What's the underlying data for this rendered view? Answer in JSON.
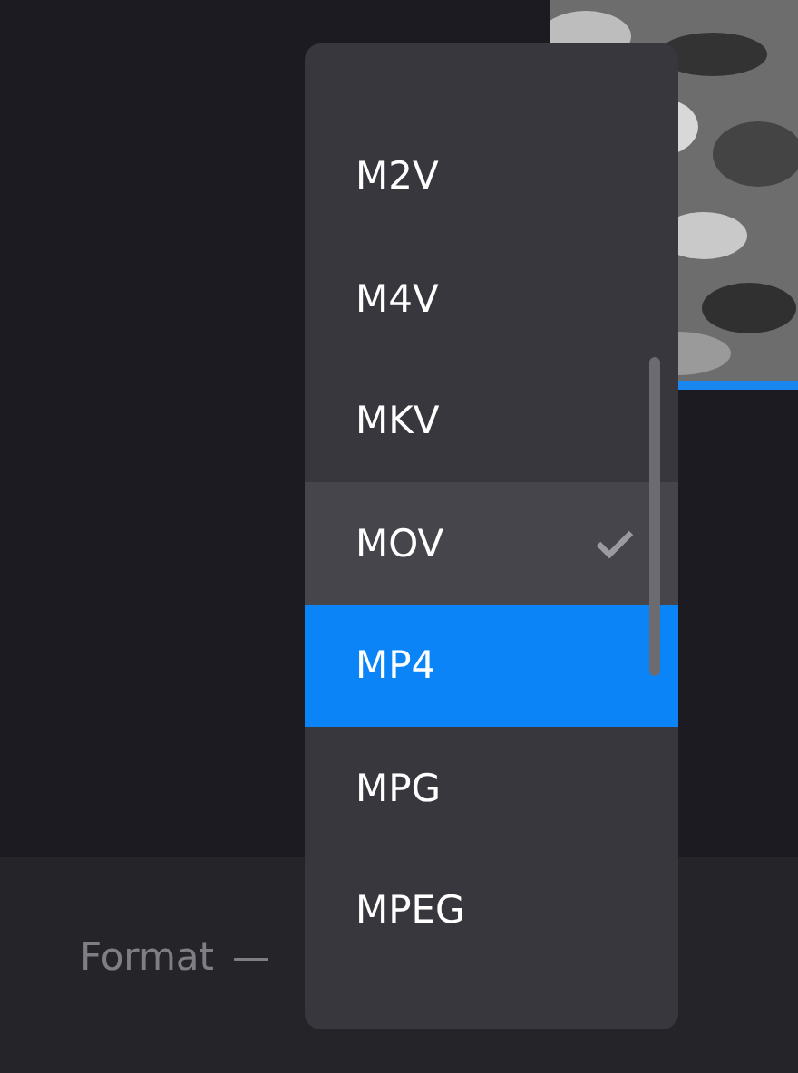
{
  "preview": {
    "kind": "picture",
    "progress": {
      "level": 1
    }
  },
  "format_menu": {
    "items": [
      {
        "label": "M2V",
        "checked": false,
        "selected": false
      },
      {
        "label": "M4V",
        "checked": false,
        "selected": false
      },
      {
        "label": "MKV",
        "checked": false,
        "selected": false
      },
      {
        "label": "MOV",
        "checked": true,
        "selected": false
      },
      {
        "label": "MP4",
        "checked": false,
        "selected": true
      },
      {
        "label": "MPG",
        "checked": false,
        "selected": false
      },
      {
        "label": "MPEG",
        "checked": false,
        "selected": false
      }
    ]
  },
  "bottom_bar": {
    "label": "Format",
    "dash": "—"
  }
}
